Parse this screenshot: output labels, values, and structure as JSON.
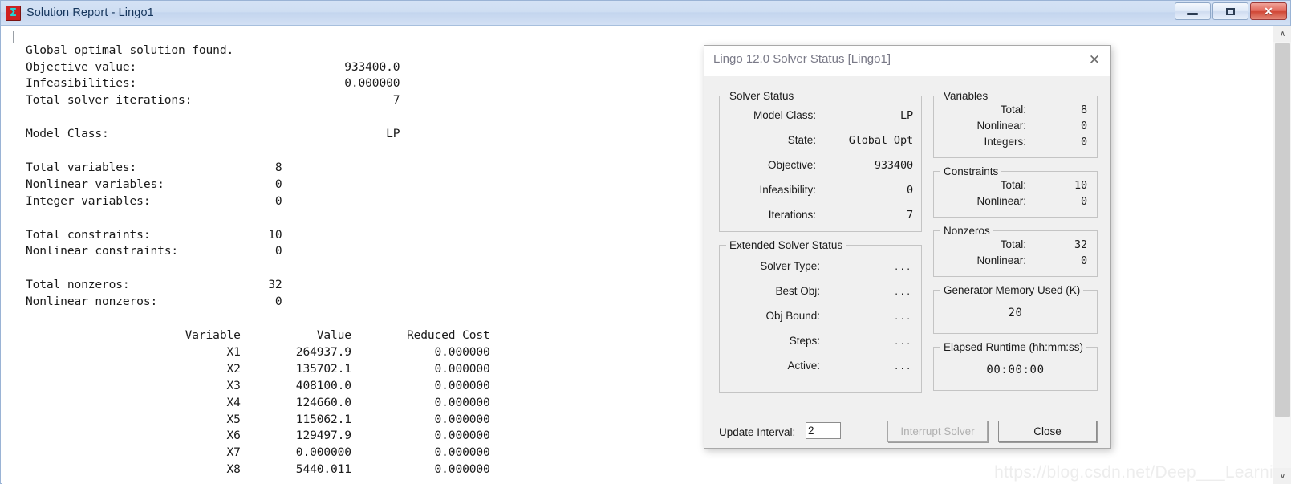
{
  "window": {
    "title": "Solution Report - Lingo1",
    "icon": "lingo-sigma-icon",
    "minimize_label": "Minimize",
    "maximize_label": "Maximize",
    "close_label": "Close"
  },
  "report": {
    "text": "Global optimal solution found.\nObjective value:                              933400.0\nInfeasibilities:                              0.000000\nTotal solver iterations:                             7\n\nModel Class:                                        LP\n\nTotal variables:                    8\nNonlinear variables:                0\nInteger variables:                  0\n\nTotal constraints:                 10\nNonlinear constraints:              0\n\nTotal nonzeros:                    32\nNonlinear nonzeros:                 0\n\n                       Variable           Value        Reduced Cost\n                             X1        264937.9            0.000000\n                             X2        135702.1            0.000000\n                             X3        408100.0            0.000000\n                             X4        124660.0            0.000000\n                             X5        115062.1            0.000000\n                             X6        129497.9            0.000000\n                             X7        0.000000            0.000000\n                             X8        5440.011            0.000000",
    "lines": {
      "status": "Global optimal solution found.",
      "objective_value_label": "Objective value:",
      "objective_value": "933400.0",
      "infeasibilities_label": "Infeasibilities:",
      "infeasibilities": "0.000000",
      "total_solver_iterations_label": "Total solver iterations:",
      "total_solver_iterations": "7",
      "model_class_label": "Model Class:",
      "model_class": "LP",
      "total_variables_label": "Total variables:",
      "total_variables": "8",
      "nonlinear_variables_label": "Nonlinear variables:",
      "nonlinear_variables": "0",
      "integer_variables_label": "Integer variables:",
      "integer_variables": "0",
      "total_constraints_label": "Total constraints:",
      "total_constraints": "10",
      "nonlinear_constraints_label": "Nonlinear constraints:",
      "nonlinear_constraints": "0",
      "total_nonzeros_label": "Total nonzeros:",
      "total_nonzeros": "32",
      "nonlinear_nonzeros_label": "Nonlinear nonzeros:",
      "nonlinear_nonzeros": "0"
    },
    "table": {
      "headers": [
        "Variable",
        "Value",
        "Reduced Cost"
      ],
      "rows": [
        [
          "X1",
          "264937.9",
          "0.000000"
        ],
        [
          "X2",
          "135702.1",
          "0.000000"
        ],
        [
          "X3",
          "408100.0",
          "0.000000"
        ],
        [
          "X4",
          "124660.0",
          "0.000000"
        ],
        [
          "X5",
          "115062.1",
          "0.000000"
        ],
        [
          "X6",
          "129497.9",
          "0.000000"
        ],
        [
          "X7",
          "0.000000",
          "0.000000"
        ],
        [
          "X8",
          "5440.011",
          "0.000000"
        ]
      ]
    }
  },
  "scrollbar": {
    "up_arrow": "∧",
    "down_arrow": "∨"
  },
  "watermark": {
    "text": "https://blog.csdn.net/Deep___Learni"
  },
  "dialog": {
    "title": "Lingo 12.0 Solver Status [Lingo1]",
    "close_icon": "✕",
    "solver_status": {
      "legend": "Solver Status",
      "rows": [
        {
          "label": "Model Class:",
          "value": "LP"
        },
        {
          "label": "State:",
          "value": "Global Opt"
        },
        {
          "label": "Objective:",
          "value": "933400"
        },
        {
          "label": "Infeasibility:",
          "value": "0"
        },
        {
          "label": "Iterations:",
          "value": "7"
        }
      ]
    },
    "extended_solver_status": {
      "legend": "Extended Solver Status",
      "rows": [
        {
          "label": "Solver Type:",
          "value": ".  .  ."
        },
        {
          "label": "Best Obj:",
          "value": ".  .  ."
        },
        {
          "label": "Obj Bound:",
          "value": ".  .  ."
        },
        {
          "label": "Steps:",
          "value": ".  .  ."
        },
        {
          "label": "Active:",
          "value": ".  .  ."
        }
      ]
    },
    "variables": {
      "legend": "Variables",
      "rows": [
        {
          "label": "Total:",
          "value": "8"
        },
        {
          "label": "Nonlinear:",
          "value": "0"
        },
        {
          "label": "Integers:",
          "value": "0"
        }
      ]
    },
    "constraints": {
      "legend": "Constraints",
      "rows": [
        {
          "label": "Total:",
          "value": "10"
        },
        {
          "label": "Nonlinear:",
          "value": "0"
        }
      ]
    },
    "nonzeros": {
      "legend": "Nonzeros",
      "rows": [
        {
          "label": "Total:",
          "value": "32"
        },
        {
          "label": "Nonlinear:",
          "value": "0"
        }
      ]
    },
    "generator_memory": {
      "legend": "Generator Memory Used (K)",
      "value": "20"
    },
    "elapsed_runtime": {
      "legend": "Elapsed Runtime (hh:mm:ss)",
      "value": "00:00:00"
    },
    "footer": {
      "update_interval_label": "Update Interval:",
      "update_interval_value": "2",
      "interrupt_button": "Interrupt Solver",
      "close_button": "Close"
    }
  },
  "colors": {
    "title_bar": "#cfdef2",
    "dialog_bg": "#f0f0f0",
    "close_button": "#cf4534",
    "accent_text": "#15355c"
  }
}
